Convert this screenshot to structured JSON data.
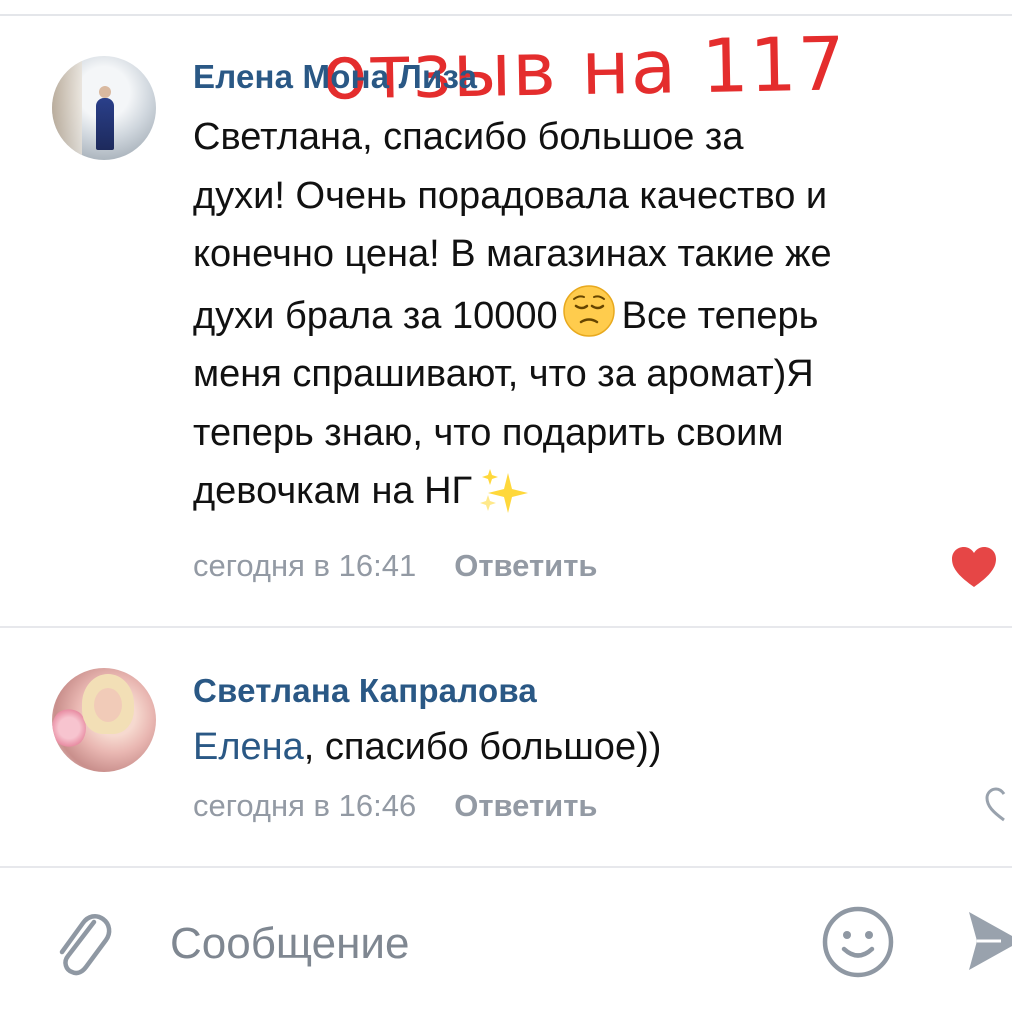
{
  "overlay_text": "отзыв на 117",
  "comments": [
    {
      "author": "Елена Мона Лиза",
      "text_line1": "Светлана, спасибо большое за",
      "text_line2": "духи! Очень порадовала качество и",
      "text_line3": "конечно цена! В магазинах такие же",
      "text_line4a": "духи брала за 10000",
      "text_line4b": "Все теперь",
      "text_line5": "меня спрашивают, что за аромат)Я",
      "text_line6": "теперь знаю, что подарить своим",
      "text_line7": "девочкам на НГ",
      "time": "сегодня в 16:41",
      "reply_label": "Ответить",
      "liked": true,
      "emoji_1": "pensive-face-icon",
      "emoji_2": "sparkles-icon"
    },
    {
      "author": "Светлана Капралова",
      "mention": "Елена",
      "text": ", спасибо большое))",
      "time": "сегодня в 16:46",
      "reply_label": "Ответить",
      "liked": false
    }
  ],
  "composer": {
    "placeholder": "Сообщение"
  },
  "colors": {
    "link": "#2a5885",
    "meta": "#939aa4",
    "like": "#e64646",
    "overlay": "#e31e1e"
  }
}
